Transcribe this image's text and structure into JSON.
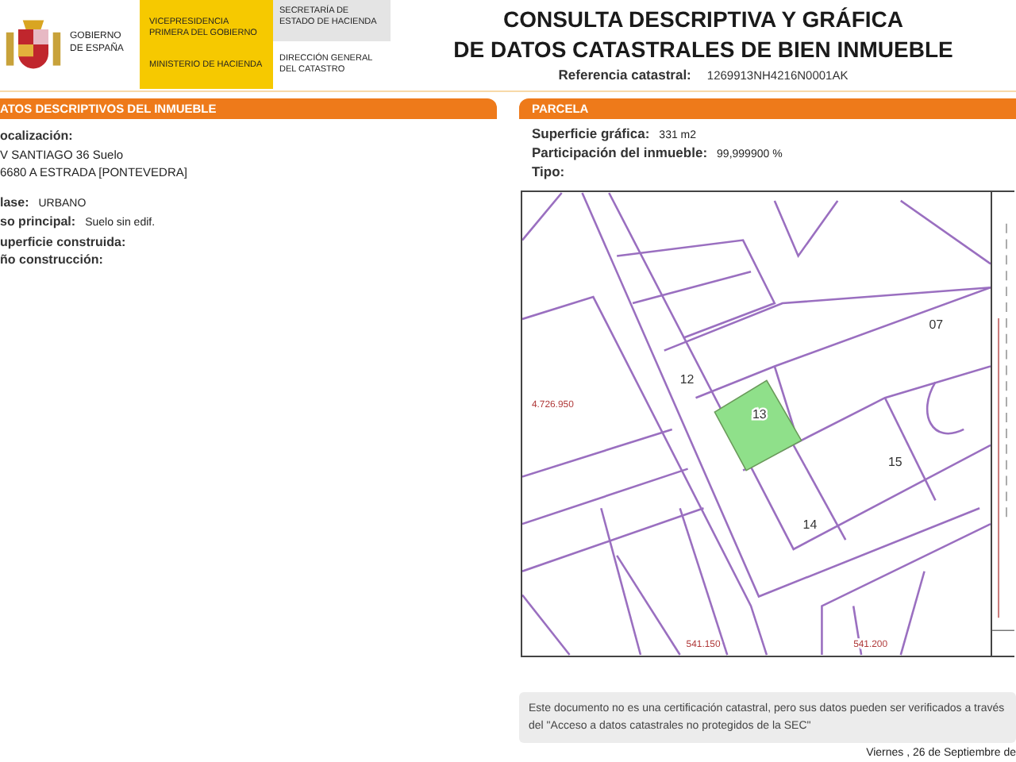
{
  "header": {
    "government": "GOBIERNO DE ESPAÑA",
    "vicepresidency": "VICEPRESIDENCIA PRIMERA DEL GOBIERNO",
    "ministry": "MINISTERIO DE HACIENDA",
    "secretariat": "SECRETARÍA DE ESTADO DE HACIENDA",
    "directorate": "DIRECCIÓN GENERAL DEL CATASTRO"
  },
  "title": {
    "lines": [
      "CONSULTA DESCRIPTIVA Y GRÁFICA",
      "DE DATOS CATASTRALES DE BIEN INMUEBLE"
    ],
    "reference_label": "Referencia catastral:",
    "reference": "1269913NH4216N0001AK"
  },
  "property": {
    "heading": "ATOS DESCRIPTIVOS DEL INMUEBLE",
    "location_label": "ocalización:",
    "address_lines": [
      "V SANTIAGO 36 Suelo",
      "6680 A ESTRADA [PONTEVEDRA]"
    ],
    "fields": [
      {
        "label": "lase:",
        "value": "URBANO"
      },
      {
        "label": "so principal:",
        "value": "Suelo sin edif."
      },
      {
        "label": "uperficie construida:"
      },
      {
        "label": "ño construcción:"
      }
    ]
  },
  "parcel": {
    "heading": "PARCELA",
    "fields": [
      {
        "label": "Superficie gráfica:",
        "value": "331 m2"
      },
      {
        "label": "Participación del inmueble:",
        "value": "99,999900 %"
      },
      {
        "label": "Tipo:"
      }
    ],
    "map": {
      "labels": [
        {
          "text": "07",
          "kind": "parcel"
        },
        {
          "text": "12",
          "kind": "parcel"
        },
        {
          "text": "13",
          "kind": "parcel"
        },
        {
          "text": "15",
          "kind": "parcel"
        },
        {
          "text": "14",
          "kind": "parcel"
        },
        {
          "text": "4.726.950",
          "kind": "coordinate"
        },
        {
          "text": "541.150",
          "kind": "coordinate"
        },
        {
          "text": "541.200",
          "kind": "coordinate"
        }
      ]
    }
  },
  "notice": "Este documento no es una certificación catastral, pero sus datos pueden ser verificados a través del \"Acceso a datos catastrales no protegidos de la SEC\"",
  "date": "Viernes , 26 de Septiembre de"
}
